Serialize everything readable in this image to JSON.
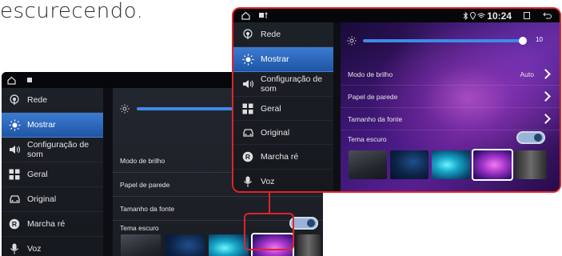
{
  "caption": "escurecendo.",
  "colors": {
    "accent_blue": "#3c8be8",
    "highlight_red": "#e0232b",
    "sidebar_active": "#2f6cc4"
  },
  "left_screen": {
    "sidebar": [
      {
        "label": "Rede",
        "icon": "network-icon",
        "active": false
      },
      {
        "label": "Mostrar",
        "icon": "brightness-icon",
        "active": true
      },
      {
        "label": "Configuração de som",
        "icon": "speaker-icon",
        "active": false
      },
      {
        "label": "Geral",
        "icon": "grid-icon",
        "active": false
      },
      {
        "label": "Original",
        "icon": "car-icon",
        "active": false
      },
      {
        "label": "Marcha ré",
        "icon": "reverse-icon",
        "active": false
      },
      {
        "label": "Voz",
        "icon": "microphone-icon",
        "active": false
      }
    ],
    "brightness_level": 0.5,
    "rows": [
      {
        "label": "Modo de brilho"
      },
      {
        "label": "Papel de parede"
      },
      {
        "label": "Tamanho da fonte"
      },
      {
        "label": "Tema escuro"
      }
    ],
    "dark_theme_on": true,
    "selected_wallpaper": 4
  },
  "right_screen": {
    "status": {
      "time": "10:24"
    },
    "sidebar": [
      {
        "label": "Rede",
        "icon": "network-icon",
        "active": false
      },
      {
        "label": "Mostrar",
        "icon": "brightness-icon",
        "active": true
      },
      {
        "label": "Configuração de som",
        "icon": "speaker-icon",
        "active": false
      },
      {
        "label": "Geral",
        "icon": "grid-icon",
        "active": false
      },
      {
        "label": "Original",
        "icon": "car-icon",
        "active": false
      },
      {
        "label": "Marcha ré",
        "icon": "reverse-icon",
        "active": false
      },
      {
        "label": "Voz",
        "icon": "microphone-icon",
        "active": false
      }
    ],
    "brightness_value": "10",
    "brightness_level": 1.0,
    "rows": [
      {
        "label": "Modo de brilho",
        "value": "Auto"
      },
      {
        "label": "Papel de parede",
        "value": ""
      },
      {
        "label": "Tamanho da fonte",
        "value": ""
      },
      {
        "label": "Tema escuro",
        "value": ""
      }
    ],
    "dark_theme_on": true,
    "selected_wallpaper": 4
  }
}
